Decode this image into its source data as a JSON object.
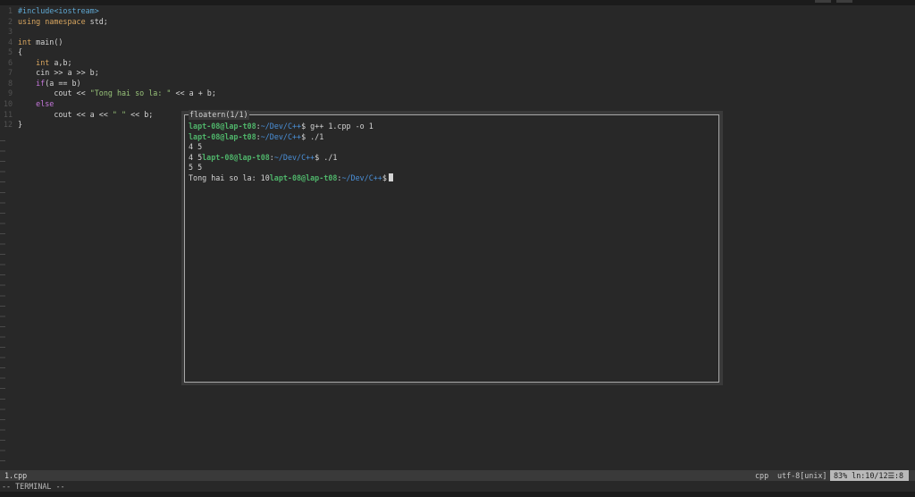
{
  "editor": {
    "lines": [
      {
        "num": "1",
        "parts": [
          {
            "t": "#include<iostream>",
            "c": "kw-pre"
          }
        ]
      },
      {
        "num": "2",
        "parts": [
          {
            "t": "using namespace",
            "c": "kw-using"
          },
          {
            "t": " std;",
            "c": "code"
          }
        ]
      },
      {
        "num": "3",
        "parts": []
      },
      {
        "num": "4",
        "parts": [
          {
            "t": "int",
            "c": "kw-type"
          },
          {
            "t": " main()",
            "c": "code"
          }
        ]
      },
      {
        "num": "5",
        "parts": [
          {
            "t": "{",
            "c": "code"
          }
        ]
      },
      {
        "num": "6",
        "parts": [
          {
            "t": "    ",
            "c": "code"
          },
          {
            "t": "int",
            "c": "kw-type"
          },
          {
            "t": " a,b;",
            "c": "code"
          }
        ]
      },
      {
        "num": "7",
        "parts": [
          {
            "t": "    cin >> a >> b;",
            "c": "code"
          }
        ]
      },
      {
        "num": "8",
        "parts": [
          {
            "t": "    ",
            "c": "code"
          },
          {
            "t": "if",
            "c": "kw-ctrl"
          },
          {
            "t": "(a == b)",
            "c": "code"
          }
        ]
      },
      {
        "num": "9",
        "parts": [
          {
            "t": "        cout << ",
            "c": "code"
          },
          {
            "t": "\"Tong hai so la: \"",
            "c": "str"
          },
          {
            "t": " << a + b;",
            "c": "code"
          }
        ]
      },
      {
        "num": "10",
        "parts": [
          {
            "t": "    ",
            "c": "code"
          },
          {
            "t": "else",
            "c": "kw-ctrl"
          }
        ]
      },
      {
        "num": "11",
        "parts": [
          {
            "t": "        cout << a << ",
            "c": "code"
          },
          {
            "t": "\" \"",
            "c": "str"
          },
          {
            "t": " << b;",
            "c": "code"
          }
        ]
      },
      {
        "num": "12",
        "parts": [
          {
            "t": "}",
            "c": "code"
          }
        ]
      }
    ]
  },
  "floaterm": {
    "title": "floatern(1/1)",
    "lines": [
      [
        {
          "t": "lapt-08@lap-t08",
          "c": "user"
        },
        {
          "t": ":",
          "c": "code"
        },
        {
          "t": "~/Dev/C++",
          "c": "path"
        },
        {
          "t": "$ g++ 1.cpp -o 1",
          "c": "code"
        }
      ],
      [
        {
          "t": "lapt-08@lap-t08",
          "c": "user"
        },
        {
          "t": ":",
          "c": "code"
        },
        {
          "t": "~/Dev/C++",
          "c": "path"
        },
        {
          "t": "$ ./1",
          "c": "code"
        }
      ],
      [
        {
          "t": "4 5",
          "c": "code"
        }
      ],
      [
        {
          "t": "4 5",
          "c": "code"
        },
        {
          "t": "lapt-08@lap-t08",
          "c": "user"
        },
        {
          "t": ":",
          "c": "code"
        },
        {
          "t": "~/Dev/C++",
          "c": "path"
        },
        {
          "t": "$ ./1",
          "c": "code"
        }
      ],
      [
        {
          "t": "5 5",
          "c": "code"
        }
      ],
      [
        {
          "t": "Tong hai so la: 10",
          "c": "code"
        },
        {
          "t": "lapt-08@lap-t08",
          "c": "user"
        },
        {
          "t": ":",
          "c": "code"
        },
        {
          "t": "~/Dev/C++",
          "c": "path"
        },
        {
          "t": "$",
          "c": "code"
        }
      ]
    ]
  },
  "statusline": {
    "file": "1.cpp",
    "filetype": "cpp",
    "encoding": "utf-8[unix]",
    "position": "83% ln:10/12☰:8"
  },
  "cmdline": {
    "mode": "-- TERMINAL --"
  },
  "colors": {
    "background": "#282828",
    "prompt_user": "#4fb46a",
    "prompt_path": "#4a90d9",
    "string": "#98c379",
    "keyword": "#d7a55f"
  }
}
